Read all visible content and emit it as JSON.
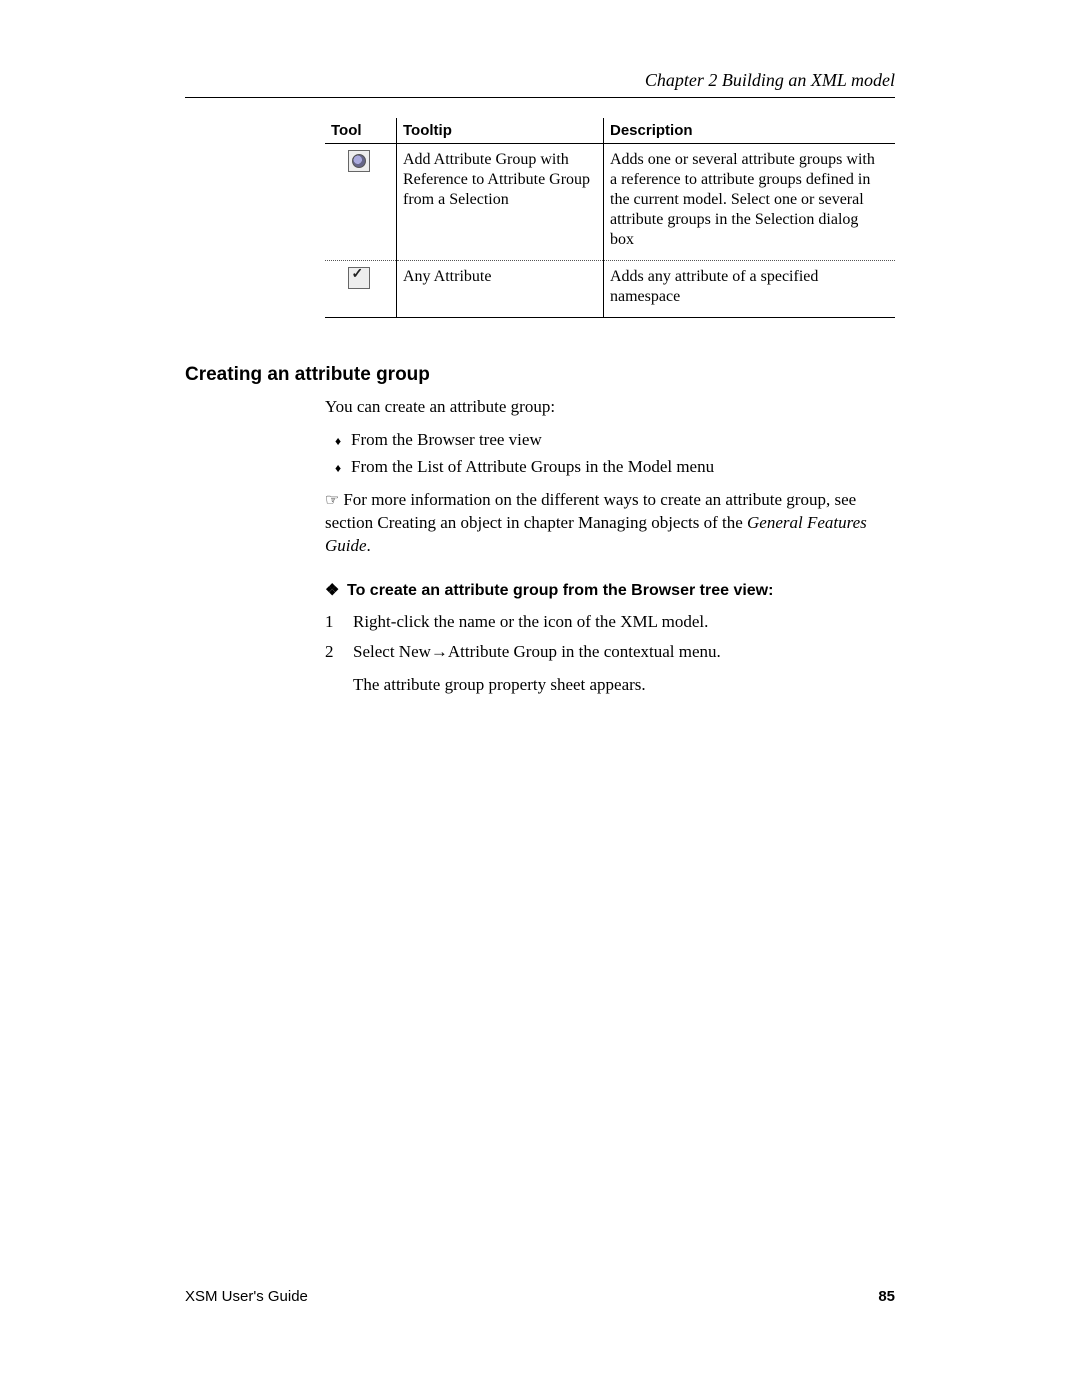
{
  "header": {
    "chapter": "Chapter 2  Building an XML model"
  },
  "table": {
    "headers": {
      "tool": "Tool",
      "tooltip": "Tooltip",
      "description": "Description"
    },
    "rows": [
      {
        "icon": "attr-group-ref-icon",
        "tooltip": "Add Attribute Group with Reference to Attribute Group from a Selection",
        "description": "Adds one or several attribute groups with a reference to attribute groups defined in the current model. Select one or several attribute groups in the Selection dialog box"
      },
      {
        "icon": "any-attribute-icon",
        "tooltip": "Any Attribute",
        "description": "Adds any attribute of a specified namespace"
      }
    ]
  },
  "section": {
    "title": "Creating an attribute group",
    "intro": "You can create an attribute group:",
    "bullets": [
      "From the Browser tree view",
      "From the List of Attribute Groups in the Model menu"
    ],
    "note_lead": "For more information on the different ways to create an attribute group, see section Creating an object in chapter Managing objects of the ",
    "note_italic": "General Features Guide",
    "note_end": ".",
    "subhead": "To create an attribute group from the Browser tree view:",
    "steps": [
      "Right-click the name or the icon of the XML model.",
      "Select New→Attribute Group in the contextual menu."
    ],
    "result": "The attribute group property sheet appears."
  },
  "footer": {
    "guide": "XSM User's Guide",
    "page": "85"
  }
}
